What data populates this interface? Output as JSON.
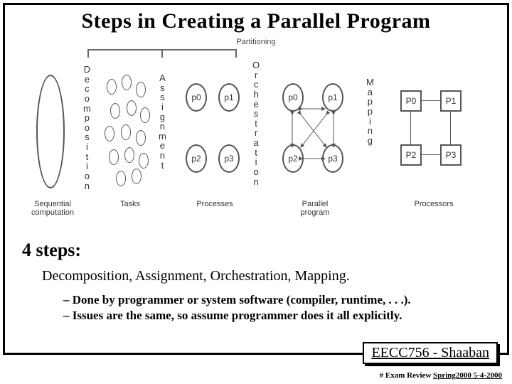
{
  "title": "Steps in Creating a Parallel Program",
  "diagram": {
    "top_label": "Partitioning",
    "stages": {
      "decomposition": "Decomposition",
      "assignment": "Assignment",
      "orchestration": "Orchestration",
      "mapping": "Mapping"
    },
    "columns": {
      "sequential": "Sequential\ncomputation",
      "tasks": "Tasks",
      "processes": "Processes",
      "parallel": "Parallel\nprogram",
      "processors": "Processors"
    },
    "proc_labels": {
      "p0": "p0",
      "p1": "p1",
      "p2": "p2",
      "p3": "p3"
    },
    "pp_labels": {
      "P0": "P0",
      "P1": "P1",
      "P2": "P2",
      "P3": "P3"
    }
  },
  "steps_heading": "4 steps:",
  "steps_line": "Decomposition, Assignment, Orchestration, Mapping.",
  "bullets": [
    "Done by programmer or system software (compiler, runtime, . . .).",
    "Issues are the same, so assume programmer does it all explicitly."
  ],
  "footer": {
    "course": "EECC756 - Shaaban",
    "meta_prefix": "#   Exam Review   ",
    "meta_suffix": "Spring2000  5-4-2000"
  }
}
